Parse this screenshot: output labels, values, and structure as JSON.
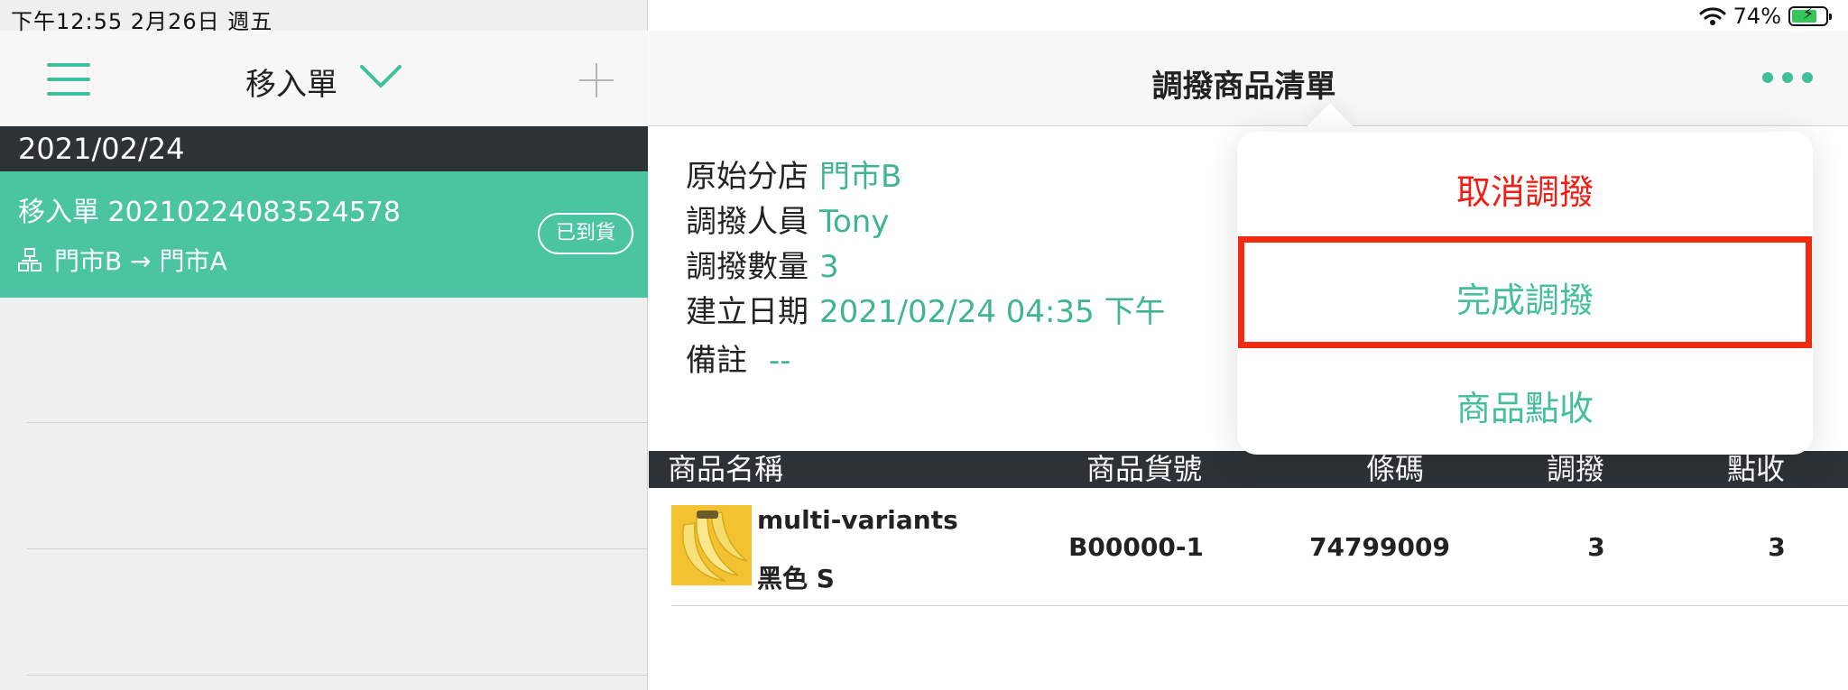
{
  "status_bar": {
    "time": "下午12:55   2月26日 週五",
    "battery": "74%",
    "battery_level": 0.74
  },
  "left_nav": {
    "title": "移入單"
  },
  "list": {
    "date_header": "2021/02/24",
    "item": {
      "title": "移入單  20210224083524578",
      "route": "門市B → 門市A",
      "badge": "已到貨"
    }
  },
  "right_nav": {
    "title": "調撥商品清單"
  },
  "info": {
    "rows": [
      {
        "label": "原始分店",
        "value": "門市B"
      },
      {
        "label": "調撥人員",
        "value": "Tony"
      },
      {
        "label": "調撥數量",
        "value": "3"
      },
      {
        "label": "建立日期",
        "value": "2021/02/24 04:35 下午"
      },
      {
        "label": "備註",
        "value": "--"
      }
    ]
  },
  "table": {
    "headers": [
      "商品名稱",
      "商品貨號",
      "條碼",
      "調撥",
      "點收"
    ],
    "rows": [
      {
        "name": "multi-variants",
        "variant": "黑色 S",
        "sku": "B00000-1",
        "barcode": "74799009",
        "transfer": "3",
        "received": "3"
      }
    ]
  },
  "menu": {
    "items": [
      {
        "label": "取消調撥",
        "color": "#f01e14"
      },
      {
        "label": "完成調撥",
        "color": "#44bf9a"
      },
      {
        "label": "商品點收",
        "color": "#44bf9a"
      }
    ]
  },
  "colors": {
    "accent": "#3fbf9a",
    "selected_row": "#4bc4a2",
    "header_dark": "#2d3236",
    "highlight": "#f22a12"
  }
}
